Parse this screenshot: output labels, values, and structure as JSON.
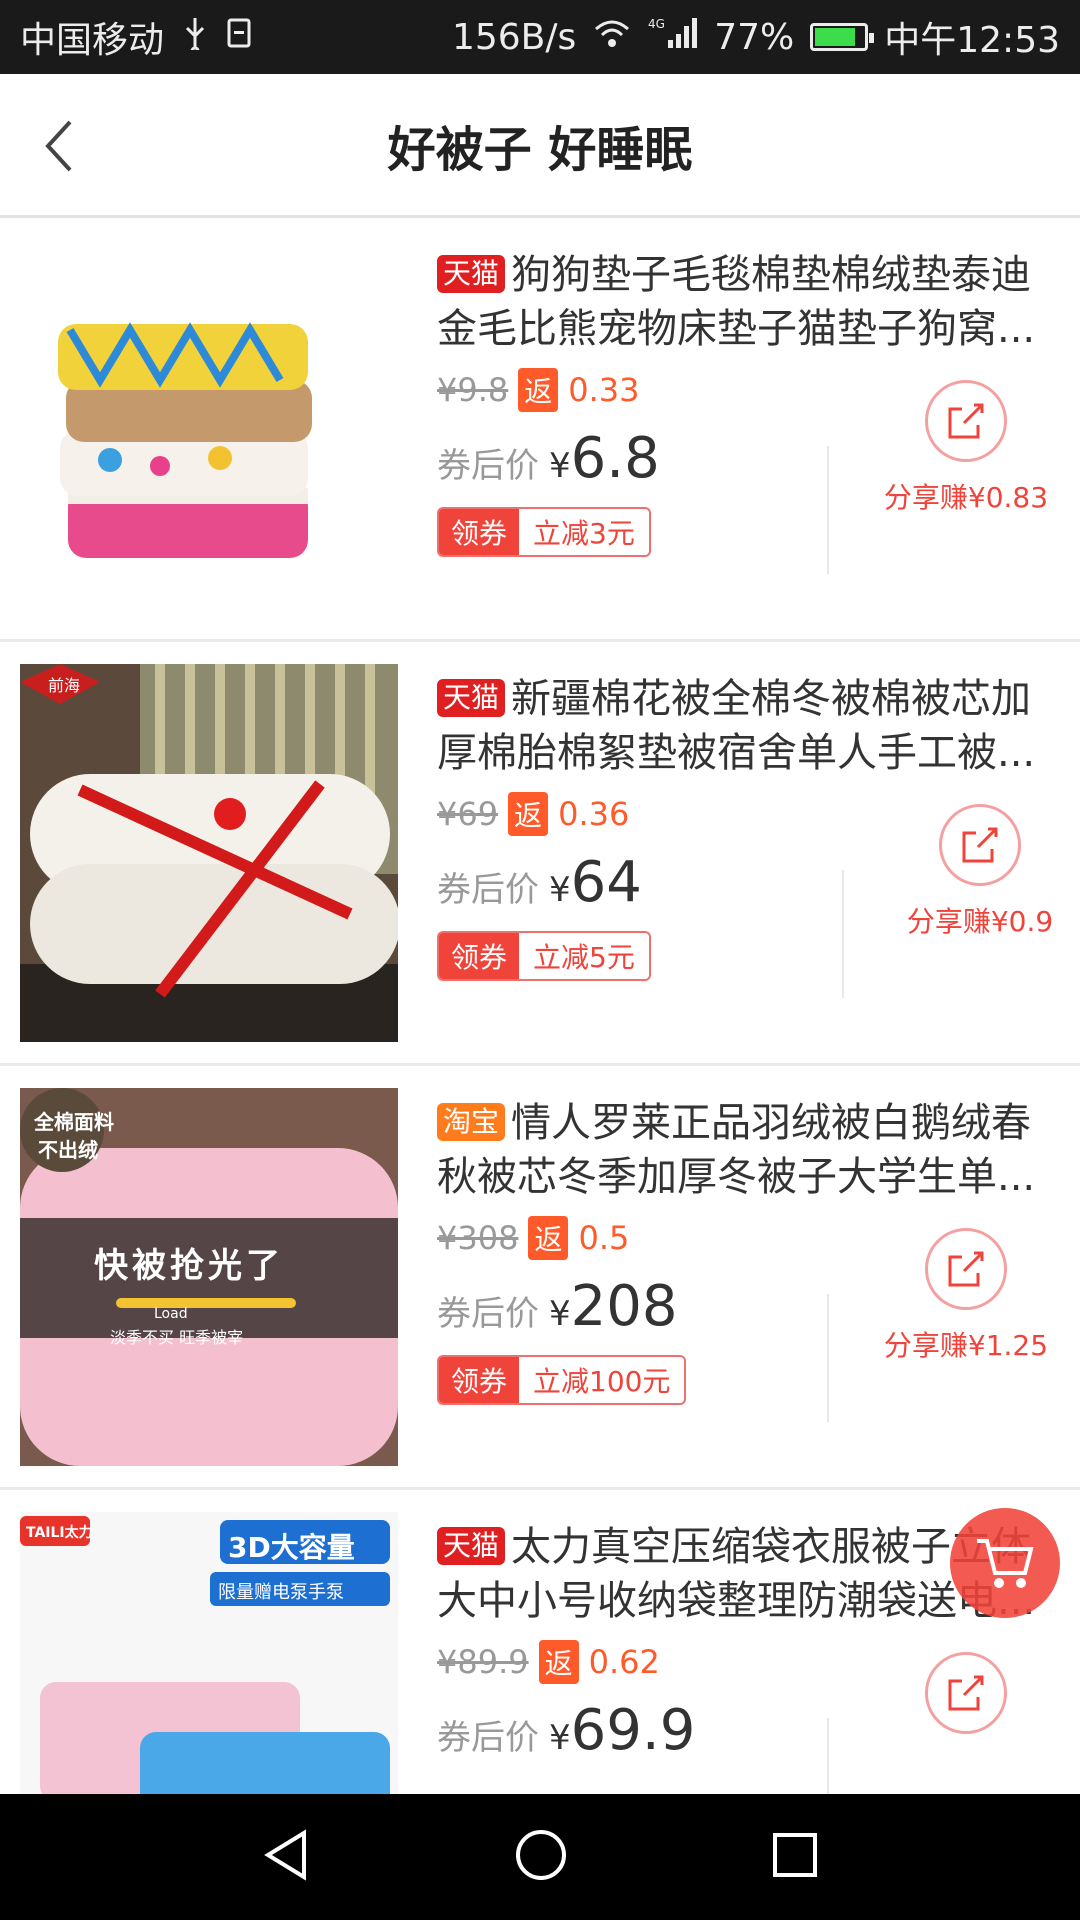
{
  "status_bar": {
    "carrier": "中国移动",
    "net_speed": "156B/s",
    "network": "4G",
    "battery": "77%",
    "time": "中午12:53"
  },
  "header": {
    "title": "好被子 好睡眠"
  },
  "items": [
    {
      "platform": "天猫",
      "title": "狗狗垫子毛毯棉垫棉绒垫泰迪金毛比熊宠物床垫子猫垫子狗窝...",
      "orig_price": "¥9.8",
      "rebate_tag": "返",
      "rebate": "0.33",
      "after_label": "券后价",
      "yen": "¥",
      "after_price": "6.8",
      "coupon_tag": "领券",
      "coupon_text": "立减3元",
      "share_label": "分享赚¥0.83"
    },
    {
      "platform": "天猫",
      "title": "新疆棉花被全棉冬被棉被芯加厚棉胎棉絮垫被宿舍单人手工被...",
      "orig_price": "¥69",
      "rebate_tag": "返",
      "rebate": "0.36",
      "after_label": "券后价",
      "yen": "¥",
      "after_price": "64",
      "coupon_tag": "领券",
      "coupon_text": "立减5元",
      "share_label": "分享赚¥0.9",
      "brand": "前海"
    },
    {
      "platform": "淘宝",
      "title": "情人罗莱正品羽绒被白鹅绒春秋被芯冬季加厚冬被子大学生单...",
      "orig_price": "¥308",
      "rebate_tag": "返",
      "rebate": "0.5",
      "after_label": "券后价",
      "yen": "¥",
      "after_price": "208",
      "coupon_tag": "领券",
      "coupon_text": "立减100元",
      "share_label": "分享赚¥1.25",
      "badge1": "全棉面料",
      "badge2": "不出绒",
      "banner": "快被抢光了",
      "load": "Load",
      "slogan": "淡季不买 旺季被宰"
    },
    {
      "platform": "天猫",
      "title": "太力真空压缩袋衣服被子立体大中小号收纳袋整理防潮袋送电...",
      "orig_price": "¥89.9",
      "rebate_tag": "返",
      "rebate": "0.62",
      "after_label": "券后价",
      "yen": "¥",
      "after_price": "69.9",
      "brand": "TAILI太力",
      "promo1": "3D大容量",
      "promo2": "限量赠电泵手泵"
    }
  ],
  "colors": {
    "accent": "#f0433a",
    "tmall": "#e02020",
    "taobao": "#ff7b1c"
  }
}
